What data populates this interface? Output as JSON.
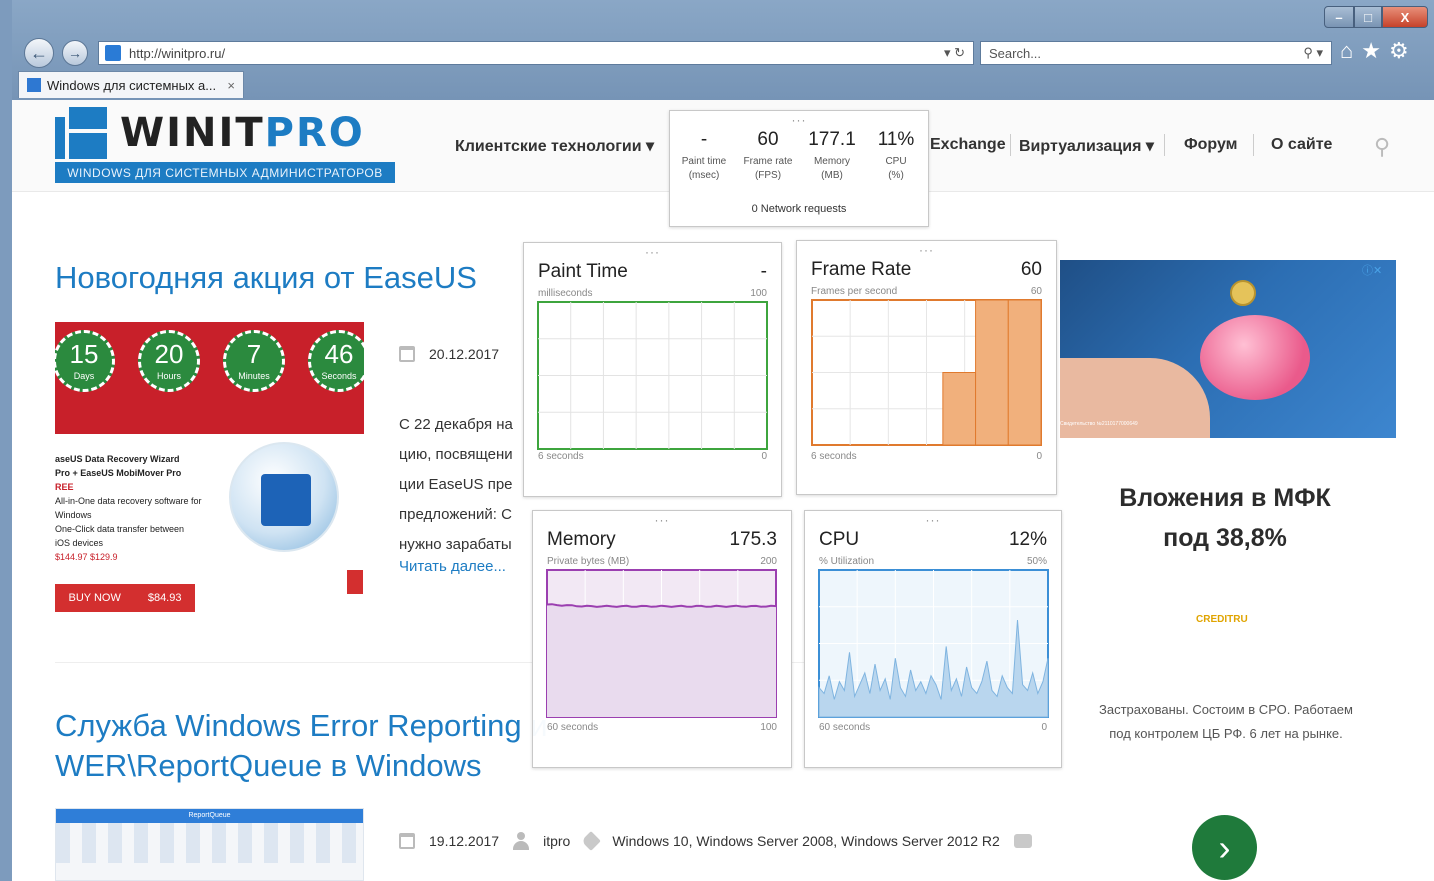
{
  "browser": {
    "url": "http://winitpro.ru/",
    "search_placeholder": "Search...",
    "tab_title": "Windows для системных а...",
    "tab_close": "×",
    "win_min": "–",
    "win_max": "□",
    "win_close": "X"
  },
  "site": {
    "logo_main": "WINIT",
    "logo_pro": "PRO",
    "logo_sub": "WINDOWS ДЛЯ СИСТЕМНЫХ АДМИНИСТРАТОРОВ",
    "menu": [
      "Клиентские технологии ▾",
      "Exchange",
      "Виртуализация ▾",
      "Форум",
      "О сайте"
    ]
  },
  "articles": [
    {
      "title": "Новогодняя акция от EaseUS",
      "date": "20.12.2017",
      "excerpt_lines": [
        "С 22 декабря на",
        "цию, посвящени",
        "ции EaseUS пре",
        "предложений: С",
        "нужно зарабаты"
      ],
      "read_more": "Читать далее...",
      "promo": {
        "timers": [
          {
            "n": "15",
            "u": "Days"
          },
          {
            "n": "20",
            "u": "Hours"
          },
          {
            "n": "7",
            "u": "Minutes"
          },
          {
            "n": "46",
            "u": "Seconds"
          }
        ],
        "lines": [
          "aseUS Data Recovery Wizard",
          "Pro + EaseUS MobiMover Pro",
          "REE",
          "All-in-One data recovery software for",
          "Windows",
          "One-Click data transfer between",
          "iOS devices",
          "$144.97 $129.9"
        ],
        "buy_label": "BUY NOW",
        "buy_price": "$84.93"
      }
    },
    {
      "title_line1": "Служба Windows Error Reporting и",
      "title_line2": "WER\\ReportQueue в Windows",
      "date": "19.12.2017",
      "author": "itpro",
      "tags": "Windows 10, Windows Server 2008, Windows Server 2012 R2",
      "thumb_title": "ReportQueue"
    }
  ],
  "ad": {
    "title_line1": "Вложения в МФК",
    "title_line2": "под 38,8%",
    "logo_a": "CR",
    "logo_b": "EDIT",
    "logo_c": "RU",
    "desc": "Застрахованы. Состоим в СРО. Работаем под контролем ЦБ РФ. 6 лет на рынке.",
    "small": "Свидетельство №2110177000649",
    "next_label": "›",
    "corner": "ⓘ✕"
  },
  "perf": {
    "summary": [
      {
        "value": "-",
        "label1": "Paint time",
        "label2": "(msec)"
      },
      {
        "value": "60",
        "label1": "Frame rate",
        "label2": "(FPS)"
      },
      {
        "value": "177.1",
        "label1": "Memory",
        "label2": "(MB)"
      },
      {
        "value": "11%",
        "label1": "CPU",
        "label2": "(%)"
      }
    ],
    "network": "0 Network requests",
    "paint": {
      "title": "Paint Time",
      "value": "-",
      "sub": "milliseconds",
      "max": "100",
      "foot": "6 seconds",
      "zero": "0"
    },
    "frame": {
      "title": "Frame Rate",
      "value": "60",
      "sub": "Frames per second",
      "max": "60",
      "foot": "6 seconds",
      "zero": "0",
      "bars": [
        0,
        0,
        0,
        0,
        30,
        60,
        60
      ]
    },
    "memory": {
      "title": "Memory",
      "value": "175.3",
      "sub": "Private bytes (MB)",
      "max": "200",
      "foot": "60 seconds",
      "zero": "100"
    },
    "cpu": {
      "title": "CPU",
      "value": "12%",
      "sub": "% Utilization",
      "max": "50%",
      "foot": "60 seconds",
      "zero": "0"
    }
  }
}
